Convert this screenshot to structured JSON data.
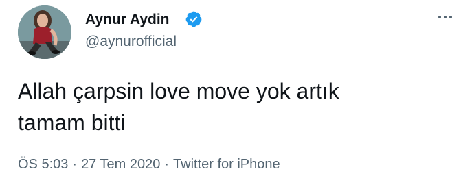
{
  "author": {
    "display_name": "Aynur Aydin",
    "handle": "@aynurofficial",
    "verified": true,
    "avatar_icon": "user-photo"
  },
  "tweet": {
    "text_line1": "Allah çarpsin love move yok artık",
    "text_line2": "tamam bitti"
  },
  "meta": {
    "time": "ÖS 5:03",
    "separator": "·",
    "date": "27 Tem 2020",
    "source": "Twitter for iPhone"
  },
  "colors": {
    "text_primary": "#0f1419",
    "text_secondary": "#536471",
    "verified_blue": "#1d9bf0"
  }
}
